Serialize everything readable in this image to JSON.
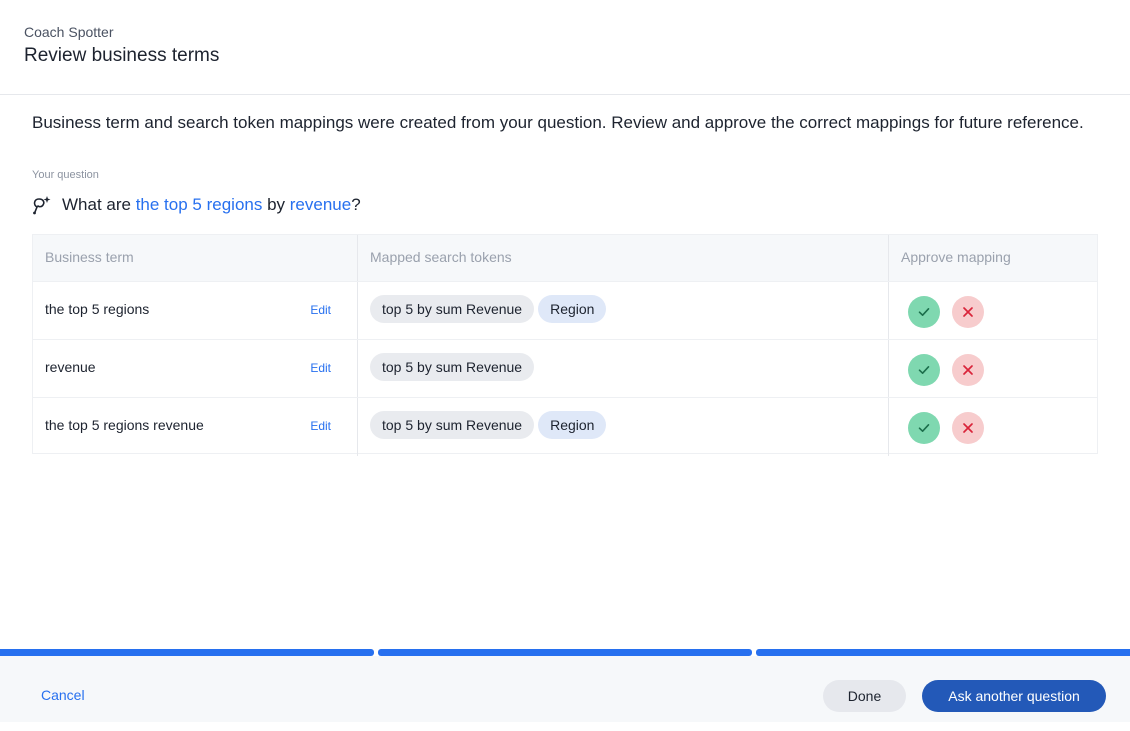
{
  "header": {
    "eyebrow": "Coach Spotter",
    "title": "Review business terms"
  },
  "intro": "Business term and search token mappings were created from your question. Review and approve the correct mappings for future reference.",
  "question": {
    "label": "Your question",
    "icon": "sparkle-lasso-icon",
    "parts": [
      "What are ",
      "the top 5 regions",
      " by ",
      "revenue",
      "?"
    ]
  },
  "table": {
    "headers": [
      "Business term",
      "Mapped search tokens",
      "Approve mapping"
    ],
    "edit_label": "Edit",
    "rows": [
      {
        "term": "the top 5 regions",
        "tokens": [
          "top 5 by sum Revenue",
          "Region"
        ]
      },
      {
        "term": "revenue",
        "tokens": [
          "top 5 by sum Revenue"
        ]
      },
      {
        "term": "the top 5 regions revenue",
        "tokens": [
          "top 5 by sum Revenue",
          "Region"
        ]
      }
    ]
  },
  "progress": {
    "steps": 3,
    "completed": 3
  },
  "footer": {
    "cancel": "Cancel",
    "done": "Done",
    "ask_another": "Ask another question"
  },
  "colors": {
    "accent": "#2770ef",
    "primary_button": "#2359b8",
    "approve": "#7fd8b0",
    "reject": "#f7cccd"
  }
}
